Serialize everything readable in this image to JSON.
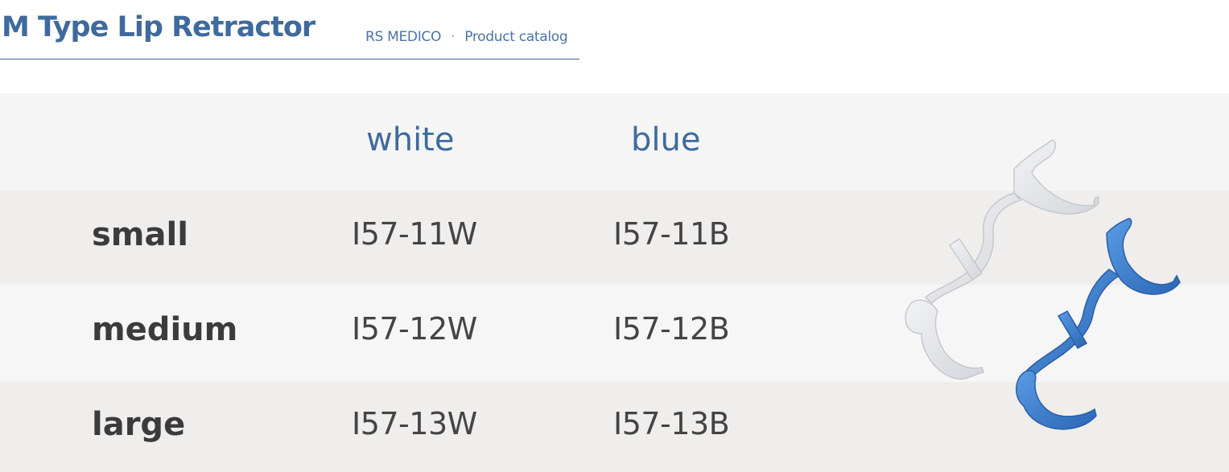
{
  "header": {
    "title": "M Type Lip Retractor",
    "brand": "RS MEDICO",
    "separator": "·",
    "catalog": "Product catalog"
  },
  "table": {
    "columns": [
      "white",
      "blue"
    ],
    "rows": [
      {
        "size": "small",
        "white": "I57-11W",
        "blue": "I57-11B"
      },
      {
        "size": "medium",
        "white": "I57-12W",
        "blue": "I57-12B"
      },
      {
        "size": "large",
        "white": "I57-13W",
        "blue": "I57-13B"
      }
    ]
  },
  "image": {
    "subject": "lip-retractor-pair",
    "colors": {
      "white": "#e4e6ea",
      "blue": "#3d7fd0",
      "accent": "#3f6a9e"
    }
  }
}
